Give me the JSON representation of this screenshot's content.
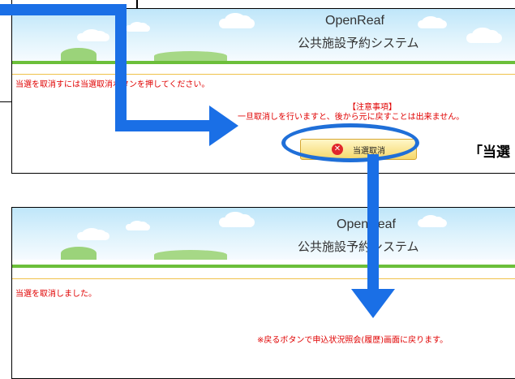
{
  "top_panel": {
    "brand": "OpenReaf",
    "system_name": "公共施設予約システム",
    "instruction": "当選を取消すには当選取消ボタンを押してください。",
    "notice_title": "【注意事項】",
    "notice_body": "一旦取消しを行いますと、後から元に戻すことは出来ません。",
    "cancel_button": "当選取消"
  },
  "callout_text": "「当選",
  "bottom_panel": {
    "brand": "OpenReaf",
    "system_name": "公共施設予約システム",
    "result": "当選を取消しました。",
    "note": "※戻るボタンで申込状況照会(履歴)画面に戻ります。"
  },
  "colors": {
    "arrow_blue": "#1a6fe6",
    "alert_red": "#e00000",
    "banner_green": "#6cbf3a"
  }
}
